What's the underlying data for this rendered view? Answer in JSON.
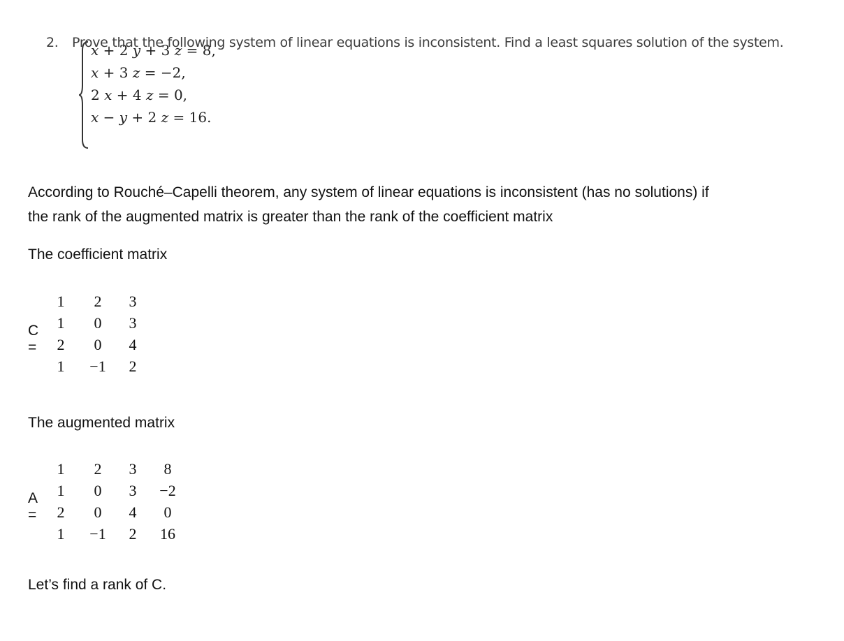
{
  "problem": {
    "number": "2.",
    "statement": "Prove that the following system of linear equations is inconsistent.  Find a least squares solution of the system.",
    "equations": [
      "x + 2 y + 3 z = 8,",
      "x + 3 z = −2,",
      "2 x + 4 z = 0,",
      "x − y + 2 z = 16."
    ]
  },
  "text": {
    "theorem_line1": "According to Rouché–Capelli theorem, any system of linear equations is inconsistent (has no solutions) if",
    "theorem_line2": "the rank of the augmented matrix is greater than the rank of the coefficient matrix",
    "coef_heading": "The coefficient matrix",
    "aug_heading": "The augmented matrix",
    "closing": "Let’s find a rank of C."
  },
  "coefficient_matrix": {
    "label": "C =",
    "rows": [
      [
        "1",
        "2",
        "3"
      ],
      [
        "1",
        "0",
        "3"
      ],
      [
        "2",
        "0",
        "4"
      ],
      [
        "1",
        "−1",
        "2"
      ]
    ]
  },
  "augmented_matrix": {
    "label": "A =",
    "rows": [
      [
        "1",
        "2",
        "3",
        "8"
      ],
      [
        "1",
        "0",
        "3",
        "−2"
      ],
      [
        "2",
        "0",
        "4",
        "0"
      ],
      [
        "1",
        "−1",
        "2",
        "16"
      ]
    ]
  }
}
